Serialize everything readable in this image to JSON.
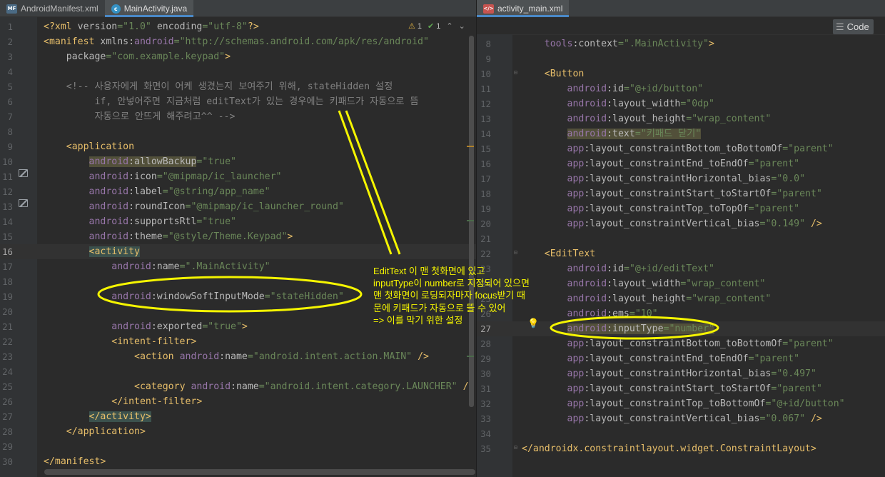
{
  "left_editor": {
    "tabs": [
      {
        "label": "AndroidManifest.xml",
        "icon": "manifest-file-icon"
      },
      {
        "label": "MainActivity.java",
        "icon": "java-class-icon"
      }
    ],
    "inspection": {
      "warnings": "1",
      "checks": "1"
    },
    "current_line": "16",
    "lines": [
      {
        "n": "1",
        "html": "<span class=\"t\">&lt;?xml </span><span class=\"a\">version</span><span class=\"v\">=\"1.0\"</span> <span class=\"a\">encoding</span><span class=\"v\">=\"utf-8\"</span><span class=\"t\">?&gt;</span>"
      },
      {
        "n": "2",
        "html": "<span class=\"t\">&lt;manifest </span><span class=\"a\">xmlns:</span><span class=\"p\">android</span><span class=\"v\">=\"http://schemas.android.com/apk/res/android\"</span>"
      },
      {
        "n": "3",
        "html": "    <span class=\"a\">package</span><span class=\"v\">=\"com.example.keypad\"</span><span class=\"t\">&gt;</span>"
      },
      {
        "n": "4",
        "html": ""
      },
      {
        "n": "5",
        "html": "    <span class=\"c\">&lt;!-- 사용자에게 화면이 어케 생겼는지 보여주기 위해, stateHidden 설정</span>"
      },
      {
        "n": "6",
        "html": "<span class=\"c\">         if, 안넣어주면 지금처럼 editText가 있는 경우에는 키패드가 자동으로 뜸</span>"
      },
      {
        "n": "7",
        "html": "<span class=\"c\">         자동으로 안뜨게 해주려고^^ --&gt;</span>"
      },
      {
        "n": "8",
        "html": ""
      },
      {
        "n": "9",
        "html": "    <span class=\"t\">&lt;application</span>"
      },
      {
        "n": "10",
        "html": "        <span class=\"p hl\">android</span><span class=\"a hl\">:allowBackup</span><span class=\"v\">=\"true\"</span>"
      },
      {
        "n": "11",
        "html": "        <span class=\"p\">android</span><span class=\"a\">:icon</span><span class=\"v\">=\"@mipmap/ic_launcher\"</span>"
      },
      {
        "n": "12",
        "html": "        <span class=\"p\">android</span><span class=\"a\">:label</span><span class=\"v\">=\"@string/app_name\"</span>"
      },
      {
        "n": "13",
        "html": "        <span class=\"p\">android</span><span class=\"a\">:roundIcon</span><span class=\"v\">=\"@mipmap/ic_launcher_round\"</span>"
      },
      {
        "n": "14",
        "html": "        <span class=\"p\">android</span><span class=\"a\">:supportsRtl</span><span class=\"v\">=\"true\"</span>"
      },
      {
        "n": "15",
        "html": "        <span class=\"p\">android</span><span class=\"a\">:theme</span><span class=\"v\">=\"@style/Theme.Keypad\"</span><span class=\"t\">&gt;</span>"
      },
      {
        "n": "16",
        "html": "        <span class=\"t hlt\">&lt;activity</span>"
      },
      {
        "n": "17",
        "html": "            <span class=\"p\">android</span><span class=\"a\">:name</span><span class=\"v\">=\".MainActivity\"</span>"
      },
      {
        "n": "18",
        "html": ""
      },
      {
        "n": "19",
        "html": "            <span class=\"p\">android</span><span class=\"a\">:windowSoftInputMode</span><span class=\"v\">=\"stateHidden\"</span>"
      },
      {
        "n": "20",
        "html": ""
      },
      {
        "n": "21",
        "html": "            <span class=\"p\">android</span><span class=\"a\">:exported</span><span class=\"v\">=\"true\"</span><span class=\"t\">&gt;</span>"
      },
      {
        "n": "22",
        "html": "            <span class=\"t\">&lt;intent-filter&gt;</span>"
      },
      {
        "n": "23",
        "html": "                <span class=\"t\">&lt;action </span><span class=\"p\">android</span><span class=\"a\">:name</span><span class=\"v\">=\"android.intent.action.MAIN\"</span> <span class=\"t\">/&gt;</span>"
      },
      {
        "n": "24",
        "html": ""
      },
      {
        "n": "25",
        "html": "                <span class=\"t\">&lt;category </span><span class=\"p\">android</span><span class=\"a\">:name</span><span class=\"v\">=\"android.intent.category.LAUNCHER\"</span> <span class=\"t\">/&gt;</span>"
      },
      {
        "n": "26",
        "html": "            <span class=\"t\">&lt;/intent-filter&gt;</span>"
      },
      {
        "n": "27",
        "html": "        <span class=\"t hlt\">&lt;/activity&gt;</span>"
      },
      {
        "n": "28",
        "html": "    <span class=\"t\">&lt;/application&gt;</span>"
      },
      {
        "n": "29",
        "html": ""
      },
      {
        "n": "30",
        "html": "<span class=\"t\">&lt;/manifest&gt;</span>"
      }
    ]
  },
  "right_editor": {
    "tabs": [
      {
        "label": "activity_main.xml",
        "icon": "layout-xml-icon"
      }
    ],
    "view_mode_label": "Code",
    "current_line": "27",
    "lines": [
      {
        "n": "8",
        "html": "    <span class=\"p\">tools</span><span class=\"a\">:context</span><span class=\"v\">=\".MainActivity\"</span><span class=\"t\">&gt;</span>"
      },
      {
        "n": "9",
        "html": ""
      },
      {
        "n": "10",
        "html": "    <span class=\"t\">&lt;Button</span>"
      },
      {
        "n": "11",
        "html": "        <span class=\"p\">android</span><span class=\"a\">:id</span><span class=\"v\">=\"@+id/button\"</span>"
      },
      {
        "n": "12",
        "html": "        <span class=\"p\">android</span><span class=\"a\">:layout_width</span><span class=\"v\">=\"0dp\"</span>"
      },
      {
        "n": "13",
        "html": "        <span class=\"p\">android</span><span class=\"a\">:layout_height</span><span class=\"v\">=\"wrap_content\"</span>"
      },
      {
        "n": "14",
        "html": "        <span class=\"p hl\">android</span><span class=\"a hl\">:text</span><span class=\"v hl\">=\"키패드 닫기\"</span>"
      },
      {
        "n": "15",
        "html": "        <span class=\"p\">app</span><span class=\"a\">:layout_constraintBottom_toBottomOf</span><span class=\"v\">=\"parent\"</span>"
      },
      {
        "n": "16",
        "html": "        <span class=\"p\">app</span><span class=\"a\">:layout_constraintEnd_toEndOf</span><span class=\"v\">=\"parent\"</span>"
      },
      {
        "n": "17",
        "html": "        <span class=\"p\">app</span><span class=\"a\">:layout_constraintHorizontal_bias</span><span class=\"v\">=\"0.0\"</span>"
      },
      {
        "n": "18",
        "html": "        <span class=\"p\">app</span><span class=\"a\">:layout_constraintStart_toStartOf</span><span class=\"v\">=\"parent\"</span>"
      },
      {
        "n": "19",
        "html": "        <span class=\"p\">app</span><span class=\"a\">:layout_constraintTop_toTopOf</span><span class=\"v\">=\"parent\"</span>"
      },
      {
        "n": "20",
        "html": "        <span class=\"p\">app</span><span class=\"a\">:layout_constraintVertical_bias</span><span class=\"v\">=\"0.149\"</span> <span class=\"t\">/&gt;</span>"
      },
      {
        "n": "21",
        "html": ""
      },
      {
        "n": "22",
        "html": "    <span class=\"t\">&lt;EditText</span>"
      },
      {
        "n": "23",
        "html": "        <span class=\"p\">android</span><span class=\"a\">:id</span><span class=\"v\">=\"@+id/editText\"</span>"
      },
      {
        "n": "24",
        "html": "        <span class=\"p\">android</span><span class=\"a\">:layout_width</span><span class=\"v\">=\"wrap_content\"</span>"
      },
      {
        "n": "25",
        "html": "        <span class=\"p\">android</span><span class=\"a\">:layout_height</span><span class=\"v\">=\"wrap_content\"</span>"
      },
      {
        "n": "26",
        "html": "        <span class=\"p\">android</span><span class=\"a\">:ems</span><span class=\"v\">=\"10\"</span>"
      },
      {
        "n": "27",
        "html": "        <span class=\"p hl\">android</span><span class=\"a hl\">:inputType</span><span class=\"v hl\">=\"number\"</span>"
      },
      {
        "n": "28",
        "html": "        <span class=\"p\">app</span><span class=\"a\">:layout_constraintBottom_toBottomOf</span><span class=\"v\">=\"parent\"</span>"
      },
      {
        "n": "29",
        "html": "        <span class=\"p\">app</span><span class=\"a\">:layout_constraintEnd_toEndOf</span><span class=\"v\">=\"parent\"</span>"
      },
      {
        "n": "30",
        "html": "        <span class=\"p\">app</span><span class=\"a\">:layout_constraintHorizontal_bias</span><span class=\"v\">=\"0.497\"</span>"
      },
      {
        "n": "31",
        "html": "        <span class=\"p\">app</span><span class=\"a\">:layout_constraintStart_toStartOf</span><span class=\"v\">=\"parent\"</span>"
      },
      {
        "n": "32",
        "html": "        <span class=\"p\">app</span><span class=\"a\">:layout_constraintTop_toBottomOf</span><span class=\"v\">=\"@+id/button\"</span>"
      },
      {
        "n": "33",
        "html": "        <span class=\"p\">app</span><span class=\"a\">:layout_constraintVertical_bias</span><span class=\"v\">=\"0.067\"</span> <span class=\"t\">/&gt;</span>"
      },
      {
        "n": "34",
        "html": ""
      },
      {
        "n": "35",
        "html": "<span class=\"t\">&lt;/androidx.constraintlayout.widget.ConstraintLayout&gt;</span>"
      }
    ]
  },
  "annotation": {
    "color": "#f5f500",
    "note": "EditText 이 맨 첫화면에 있고\ninputType이 number로 지정되어 있으면\n맨 첫화면이 로딩되자마자 focus받기 때\n문에 키패드가 자동으로 뜰 수 있어\n=> 이를 막기 위한 설정"
  },
  "colors": {
    "editor_bg": "#2b2b2b",
    "gutter_bg": "#313335",
    "tag": "#e8bf6a",
    "namespace": "#9876aa",
    "attribute": "#bababa",
    "value": "#6a8759",
    "comment": "#808080"
  }
}
